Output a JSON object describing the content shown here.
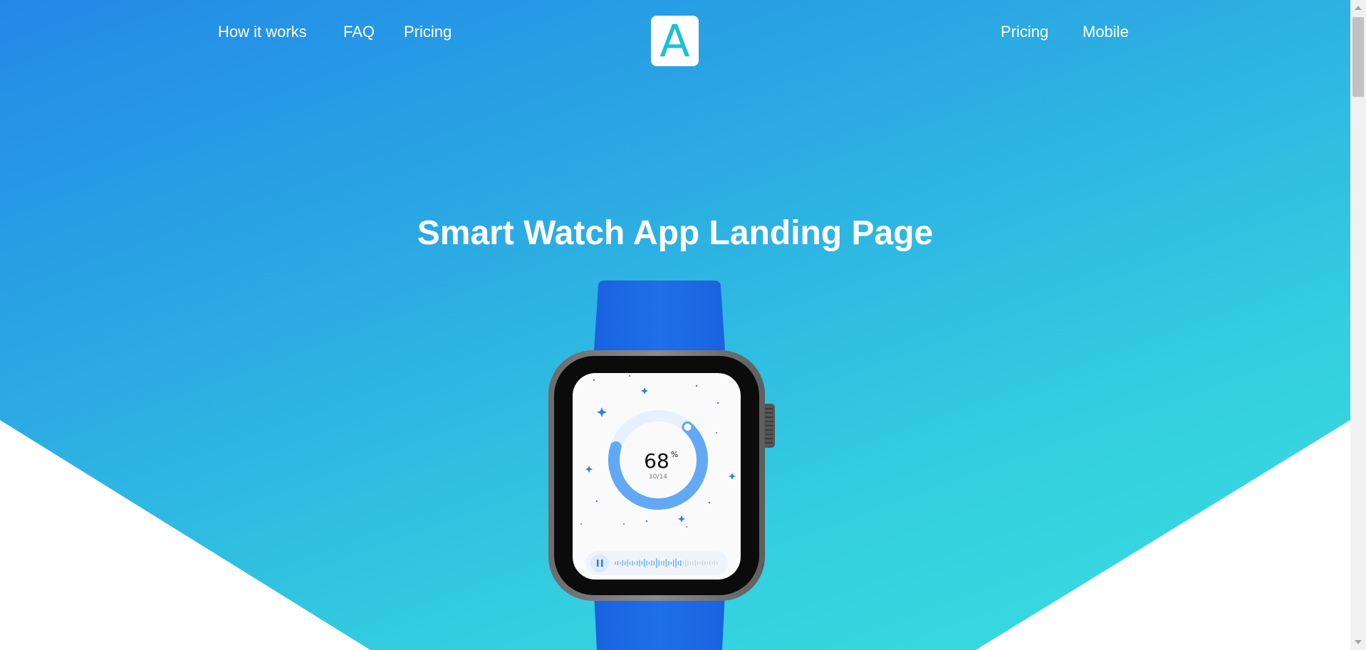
{
  "nav": {
    "left": [
      {
        "label": "How it works"
      },
      {
        "label": "FAQ"
      },
      {
        "label": "Pricing"
      }
    ],
    "right": [
      {
        "label": "Pricing"
      },
      {
        "label": "Mobile"
      }
    ],
    "logo_letter": "A"
  },
  "hero": {
    "title": "Smart Watch App Landing Page"
  },
  "watch": {
    "progress_value": "68",
    "progress_unit": "%",
    "progress_fraction": 0.68,
    "progress_sub": "10/14"
  },
  "colors": {
    "gradient_start": "#2389e8",
    "gradient_end": "#38e0e0",
    "band": "#1e6fe8",
    "logo_letter": "#1cc0d6",
    "ring": "#62a8f5",
    "ring_track": "#e6f1fd"
  }
}
